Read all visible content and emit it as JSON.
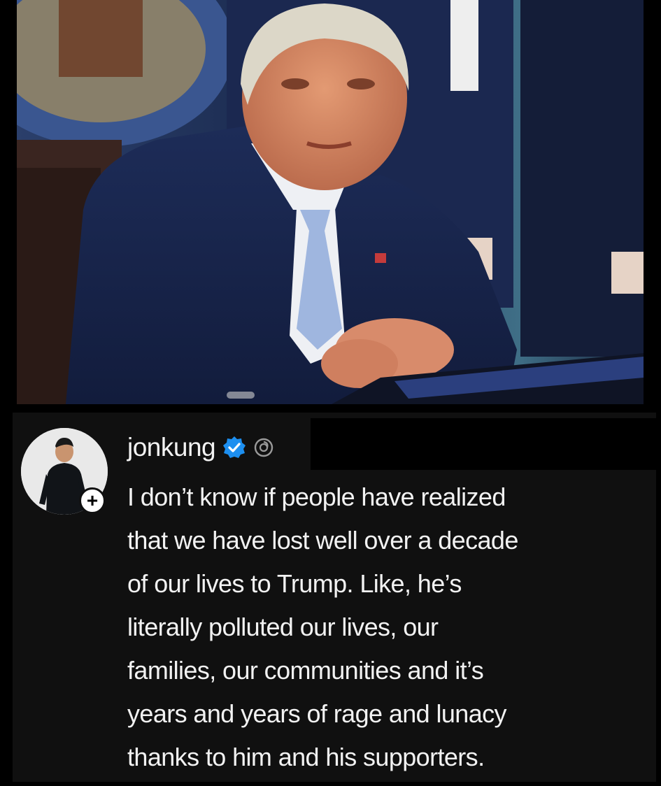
{
  "post": {
    "username": "jonkung",
    "text": "I don’t know if people have realized\nthat we have lost well over a decade\nof our lives to Trump. Like, he’s\nliterally polluted our lives, our\nfamilies, our communities and it’s\nyears and years of rage and lunacy\nthanks to him and his supporters.",
    "follow_symbol": "+"
  },
  "icons": {
    "verified": "verified-badge-icon",
    "threads": "threads-logo-icon"
  },
  "colors": {
    "background": "#000000",
    "post_background": "#101010",
    "text": "#f2f2f2",
    "verified_blue": "#1d8ff0"
  }
}
